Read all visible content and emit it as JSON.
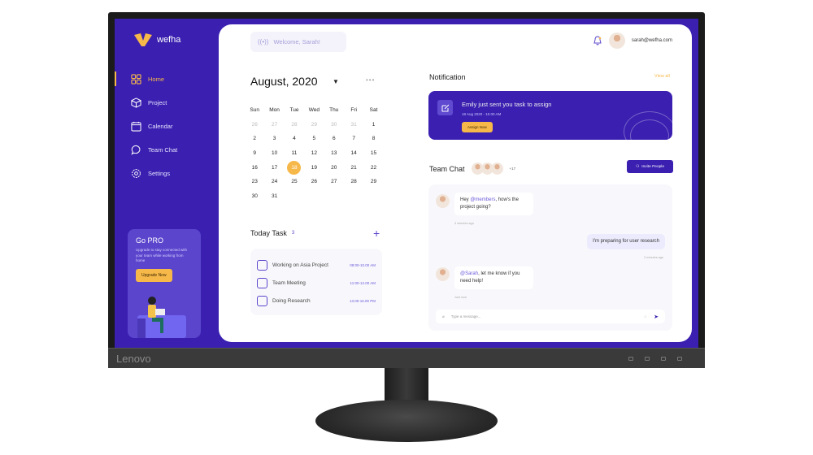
{
  "monitor": {
    "brand": "Lenovo"
  },
  "app": {
    "name": "wefha",
    "accent": "#3a1fb0",
    "highlight": "#f7b84a"
  },
  "sidebar": {
    "items": [
      {
        "label": "Home",
        "icon": "grid-icon",
        "active": true
      },
      {
        "label": "Project",
        "icon": "cube-icon"
      },
      {
        "label": "Calendar",
        "icon": "calendar-icon"
      },
      {
        "label": "Team Chat",
        "icon": "chat-icon"
      },
      {
        "label": "Settings",
        "icon": "gear-icon"
      }
    ]
  },
  "promo": {
    "title": "Go PRO",
    "text": "Upgrade to stay connected with your team while working from home",
    "button": "Upgrade Now"
  },
  "header": {
    "welcome": "Welcome, Sarah!",
    "email": "sarah@wefha.com"
  },
  "calendar": {
    "month": "August, 2020",
    "selected": "18",
    "weekdays": [
      "Sun",
      "Mon",
      "Tue",
      "Wed",
      "Thu",
      "Fri",
      "Sat"
    ],
    "prev_days": [
      "26",
      "27",
      "28",
      "29",
      "30",
      "31"
    ],
    "days": [
      "1",
      "2",
      "3",
      "4",
      "5",
      "6",
      "7",
      "8",
      "9",
      "10",
      "11",
      "12",
      "13",
      "14",
      "15",
      "16",
      "17",
      "18",
      "19",
      "20",
      "21",
      "22",
      "23",
      "24",
      "25",
      "26",
      "27",
      "28",
      "29",
      "30",
      "31"
    ]
  },
  "tasks": {
    "title": "Today Task",
    "count": "3",
    "items": [
      {
        "label": "Working on Asia Project",
        "time": "08:00-10.00 AM"
      },
      {
        "label": "Team Meeting",
        "time": "11:00-12.00 AM"
      },
      {
        "label": "Doing Research",
        "time": "13.00-16.00 PM"
      }
    ]
  },
  "notification": {
    "title": "Notification",
    "view_all": "View all",
    "message": "Emily just sent you task to assign",
    "date": "18 Aug 2020 - 10.00 AM",
    "button": "Assign Now"
  },
  "team_chat": {
    "title": "Team Chat",
    "more": "+17",
    "invite": "Invite People",
    "messages": [
      {
        "mention": "@members",
        "text_before": "Hey ",
        "text_after": ", how's the project going?",
        "time": "3 minutes ago"
      },
      {
        "text": "I'm preparing for user research",
        "time": "2 minutes ago"
      },
      {
        "mention": "@Sarah",
        "text_after": ", let me know if you need help!",
        "time": "Just now"
      }
    ],
    "placeholder": "Type a message..."
  }
}
